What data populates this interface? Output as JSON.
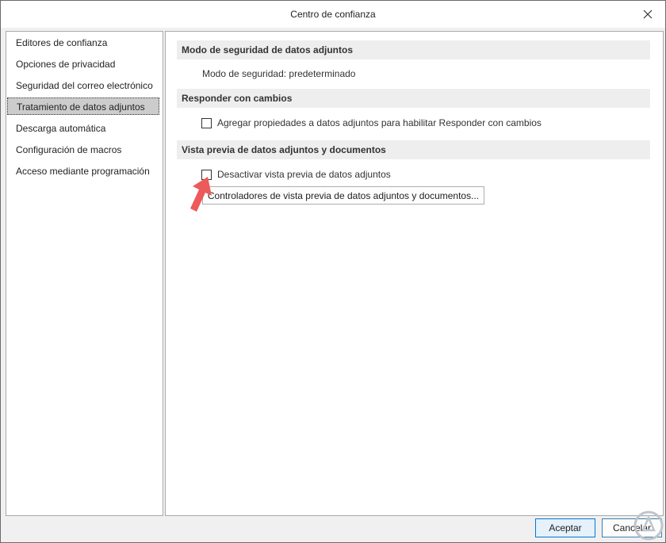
{
  "window": {
    "title": "Centro de confianza"
  },
  "sidebar": {
    "items": [
      {
        "label": "Editores de confianza",
        "selected": false
      },
      {
        "label": "Opciones de privacidad",
        "selected": false
      },
      {
        "label": "Seguridad del correo electrónico",
        "selected": false
      },
      {
        "label": "Tratamiento de datos adjuntos",
        "selected": true
      },
      {
        "label": "Descarga automática",
        "selected": false
      },
      {
        "label": "Configuración de macros",
        "selected": false
      },
      {
        "label": "Acceso mediante programación",
        "selected": false
      }
    ]
  },
  "main": {
    "section1": {
      "header": "Modo de seguridad de datos adjuntos",
      "mode_text": "Modo de seguridad: predeterminado"
    },
    "section2": {
      "header": "Responder con cambios",
      "checkbox_label": "Agregar propiedades a datos adjuntos para habilitar Responder con cambios",
      "checked": false
    },
    "section3": {
      "header": "Vista previa de datos adjuntos y documentos",
      "checkbox_label": "Desactivar vista previa de datos adjuntos",
      "checked": false,
      "button_label": "Controladores de vista previa de datos adjuntos y documentos..."
    }
  },
  "footer": {
    "ok_label": "Aceptar",
    "cancel_label": "Cancelar"
  },
  "colors": {
    "arrow": "#ec5a5a",
    "selected_bg": "#cccccc",
    "header_bg": "#eeeeee"
  }
}
